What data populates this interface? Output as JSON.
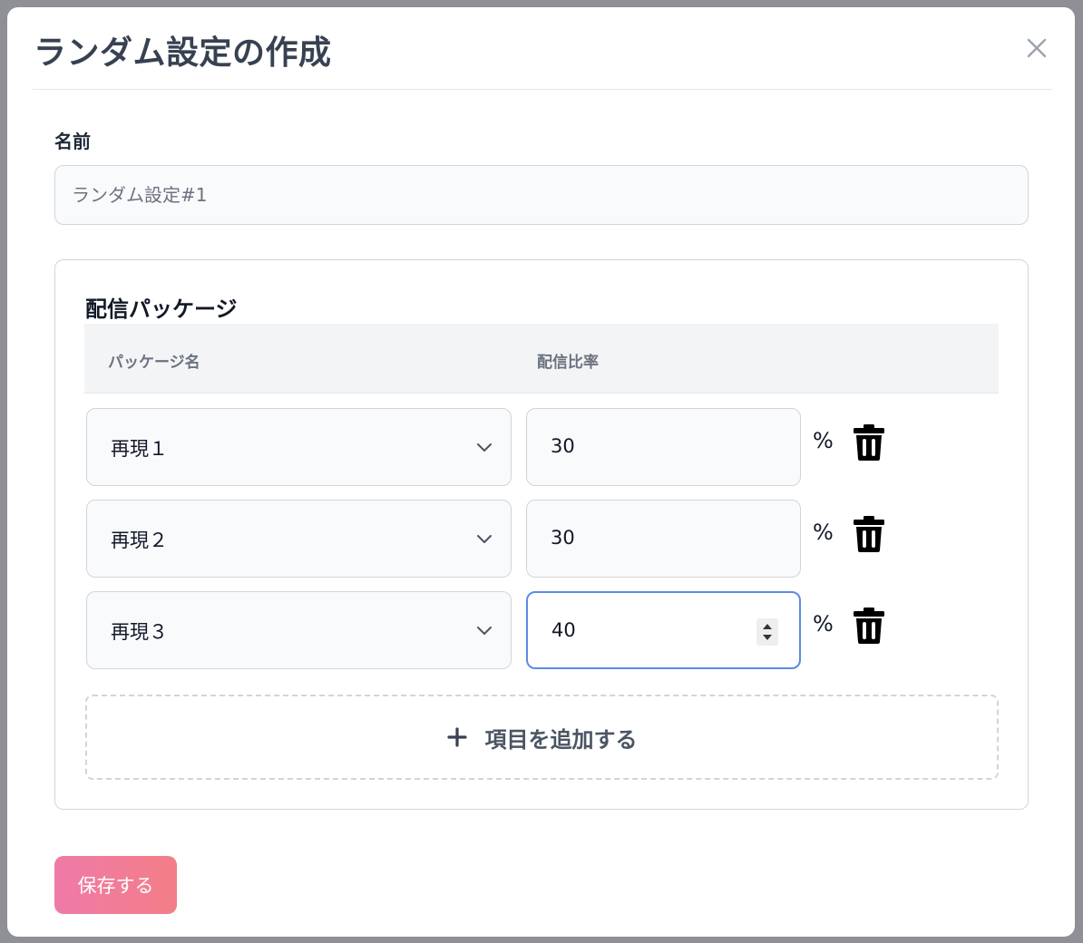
{
  "modal": {
    "title": "ランダム設定の作成",
    "close_icon": "close-icon"
  },
  "name_field": {
    "label": "名前",
    "placeholder": "ランダム設定#1",
    "value": ""
  },
  "packages": {
    "title": "配信パッケージ",
    "columns": [
      "パッケージ名",
      "配信比率"
    ],
    "rows": [
      {
        "package": "再現１",
        "rate": "30",
        "unit": "%"
      },
      {
        "package": "再現２",
        "rate": "30",
        "unit": "%"
      },
      {
        "package": "再現３",
        "rate": "40",
        "unit": "%"
      }
    ],
    "add_label": "項目を追加する",
    "add_icon": "plus-icon"
  },
  "save_label": "保存する",
  "colors": {
    "accent_gradient_start": "#f07aa8",
    "accent_gradient_end": "#f27e87",
    "focus_border": "#5b8ce6"
  }
}
